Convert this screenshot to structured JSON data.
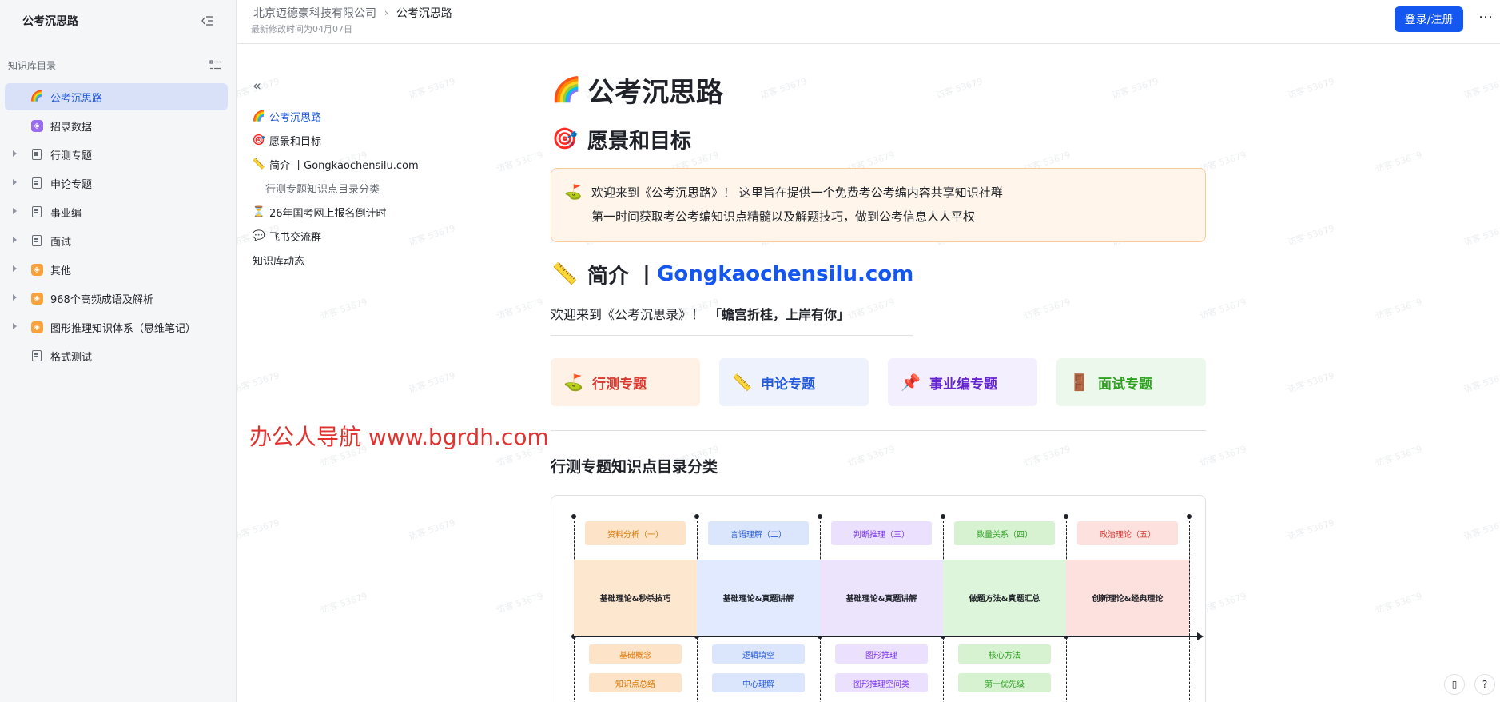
{
  "sidebar": {
    "title": "公考沉思路",
    "section_label": "知识库目录",
    "items": [
      {
        "label": "公考沉思路",
        "icon": "rainbow-icon",
        "glyph": "🌈",
        "active": true,
        "expandable": false
      },
      {
        "label": "招录数据",
        "icon": "purple-square-icon",
        "glyph": "",
        "active": false,
        "expandable": false
      },
      {
        "label": "行测专题",
        "icon": "document-icon",
        "glyph": "",
        "active": false,
        "expandable": true
      },
      {
        "label": "申论专题",
        "icon": "document-icon",
        "glyph": "",
        "active": false,
        "expandable": true
      },
      {
        "label": "事业编",
        "icon": "document-icon",
        "glyph": "",
        "active": false,
        "expandable": true
      },
      {
        "label": "面试",
        "icon": "document-icon",
        "glyph": "",
        "active": false,
        "expandable": true
      },
      {
        "label": "其他",
        "icon": "orange-square-icon",
        "glyph": "",
        "active": false,
        "expandable": true
      },
      {
        "label": "968个高频成语及解析",
        "icon": "orange-square-icon",
        "glyph": "",
        "active": false,
        "expandable": true
      },
      {
        "label": "图形推理知识体系（思维笔记）",
        "icon": "orange-square-icon",
        "glyph": "",
        "active": false,
        "expandable": true
      },
      {
        "label": "格式测试",
        "icon": "document-icon",
        "glyph": "",
        "active": false,
        "expandable": false
      }
    ]
  },
  "topbar": {
    "org": "北京迈德豪科技有限公司",
    "current": "公考沉思路",
    "updated": "最新修改时间为04月07日",
    "login_label": "登录/注册",
    "more_label": "⋯"
  },
  "outline": {
    "items": [
      {
        "label": "公考沉思路",
        "glyph": "🌈",
        "active": true,
        "sub": false
      },
      {
        "label": "愿景和目标",
        "glyph": "🎯",
        "active": false,
        "sub": false
      },
      {
        "label": "简介 丨Gongkaochensilu.com",
        "glyph": "📏",
        "active": false,
        "sub": false
      },
      {
        "label": "行测专题知识点目录分类",
        "glyph": "",
        "active": false,
        "sub": true
      },
      {
        "label": "26年国考网上报名倒计时",
        "glyph": "⏳",
        "active": false,
        "sub": false
      },
      {
        "label": "飞书交流群",
        "glyph": "💬",
        "active": false,
        "sub": false
      },
      {
        "label": "知识库动态",
        "glyph": "",
        "active": false,
        "sub": false
      }
    ]
  },
  "overlay_text": "办公人导航 www.bgrdh.com",
  "watermark": "访客 53679",
  "doc": {
    "title": "公考沉思路",
    "title_glyph": "🌈",
    "h2_vision": "愿景和目标",
    "h2_vision_glyph": "🎯",
    "callout_glyph": "⛳",
    "callout_line1": "欢迎来到《公考沉思路》！ 这里旨在提供一个免费考公考编内容共享知识社群",
    "callout_line2": "第一时间获取考公考编知识点精髓以及解题技巧，做到公考信息人人平权",
    "h2_intro_prefix": "简介 丨",
    "h2_intro_link": "Gongkaochensilu.com",
    "h2_intro_glyph": "📏",
    "intro_text": "欢迎来到《公考沉思录》！",
    "intro_bold": "「蟾宫折桂，上岸有你」",
    "cards": [
      {
        "label": "行测专题",
        "glyph": "⛳",
        "bg": "#fff1e6",
        "color": "#d83931"
      },
      {
        "label": "申论专题",
        "glyph": "📏",
        "bg": "#edf2fd",
        "color": "#245bdb"
      },
      {
        "label": "事业编专题",
        "glyph": "📌",
        "bg": "#f3efff",
        "color": "#6425d0"
      },
      {
        "label": "面试专题",
        "glyph": "🚪",
        "bg": "#ecf8ec",
        "color": "#2ea121"
      }
    ],
    "h3": "行测专题知识点目录分类"
  },
  "diagram": {
    "columns": [
      {
        "head": "资料分析（一）",
        "band": "基础理论&秒杀技巧",
        "head_bg": "#fde3c7",
        "head_color": "#de7802",
        "band_bg": "#fee7cf",
        "chips": [
          "基础概念",
          "知识点总结"
        ],
        "chip_bg": "#fde3c7",
        "chip_color": "#de7802"
      },
      {
        "head": "言语理解（二）",
        "band": "基础理论&真题讲解",
        "head_bg": "#dbe6fd",
        "head_color": "#245bdb",
        "band_bg": "#e1eafe",
        "chips": [
          "逻辑填空",
          "中心理解"
        ],
        "chip_bg": "#dbe6fd",
        "chip_color": "#245bdb"
      },
      {
        "head": "判断推理（三）",
        "band": "基础理论&真题讲解",
        "head_bg": "#ebe0fd",
        "head_color": "#7a35f0",
        "band_bg": "#ece3fd",
        "chips": [
          "图形推理",
          "图形推理空间类"
        ],
        "chip_bg": "#ebe0fd",
        "chip_color": "#7a35f0"
      },
      {
        "head": "数量关系（四）",
        "band": "做题方法&真题汇总",
        "head_bg": "#d6f2d1",
        "head_color": "#2ea121",
        "band_bg": "#ddf5da",
        "chips": [
          "核心方法",
          "第一优先级"
        ],
        "chip_bg": "#d6f2d1",
        "chip_color": "#2ea121"
      },
      {
        "head": "政治理论（五）",
        "band": "创新理论&经典理论",
        "head_bg": "#fde1de",
        "head_color": "#d83931",
        "band_bg": "#fde1de",
        "chips": [],
        "chip_bg": "#fde1de",
        "chip_color": "#d83931"
      }
    ]
  },
  "fab": {
    "doc_label": "▯",
    "help_label": "?"
  }
}
